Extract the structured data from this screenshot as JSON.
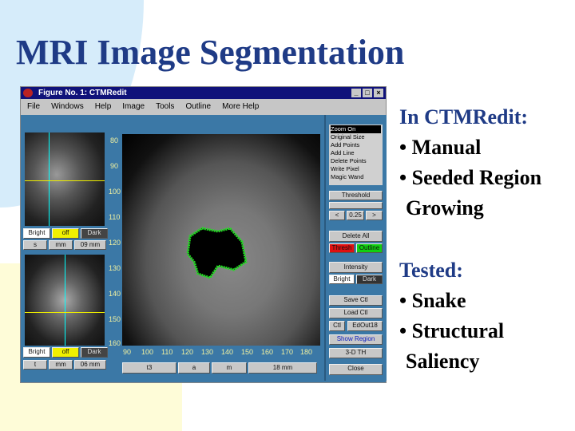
{
  "slide": {
    "title": "MRI Image Segmentation",
    "bullets1": {
      "heading": "In CTMRedit:",
      "items": [
        "• Manual",
        "• Seeded Region",
        "Growing"
      ]
    },
    "bullets2": {
      "heading": "Tested:",
      "items": [
        "• Snake",
        "• Structural",
        "Saliency"
      ]
    }
  },
  "window": {
    "title": "Figure No. 1: CTMRedit",
    "menu": [
      "File",
      "Windows",
      "Help",
      "Image",
      "Tools",
      "Outline",
      "More Help"
    ],
    "left_top": {
      "bright": "Bright",
      "off": "off",
      "dark": "Dark",
      "dd": [
        "s",
        "mm",
        "09 mm"
      ]
    },
    "left_bottom": {
      "bright": "Bright",
      "off": "off",
      "dark": "Dark",
      "dd": [
        "t",
        "mm",
        "06 mm"
      ]
    },
    "y_ticks": [
      "80",
      "90",
      "100",
      "110",
      "120",
      "130",
      "140",
      "150",
      "160"
    ],
    "x_ticks": [
      "90",
      "100",
      "110",
      "120",
      "130",
      "140",
      "150",
      "160",
      "170",
      "180"
    ],
    "bottom_dd": [
      "t3",
      "a",
      "m",
      "18 mm"
    ],
    "right": {
      "tools": [
        "Zoom On",
        "Original Size",
        "Add Points",
        "Add Line",
        "Delete Points",
        "Write Pixel",
        "Magic Wand"
      ],
      "threshold": "Threshold",
      "value": "0.25",
      "prev": "<",
      "next": ">",
      "delete_all": "Delete All",
      "thresh": "Thresh",
      "outline": "Outline",
      "intensity": "Intensity",
      "bright": "Bright",
      "dark": "Dark",
      "save": "Save Ctl",
      "load": "Load Ctl",
      "ctl": "Ctl",
      "edout": "EdOut18",
      "show_region": "Show Region",
      "three_d": "3-D TH",
      "close": "Close"
    },
    "colors": {
      "thresh": "#e01010",
      "outline": "#10d010",
      "off": "#f0f000",
      "seg": "#20e020"
    }
  }
}
